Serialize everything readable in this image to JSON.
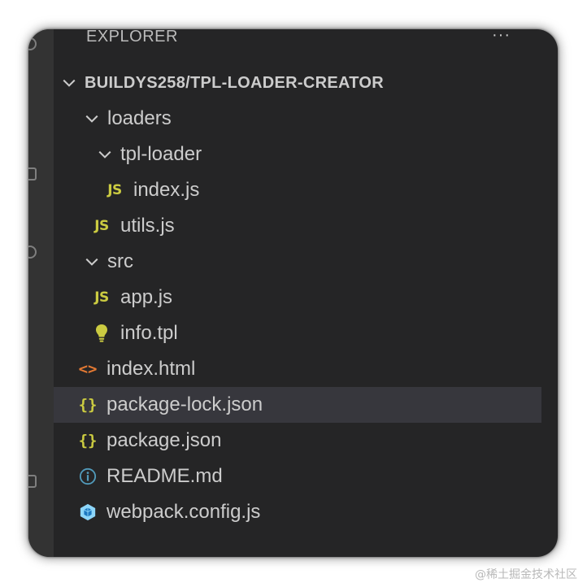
{
  "explorer": {
    "header": "EXPLORER",
    "more": "···"
  },
  "tree": {
    "root": {
      "label": "BUILDYS258/TPL-LOADER-CREATOR",
      "icon": "chevron-down-icon"
    },
    "items": [
      {
        "label": "loaders",
        "type": "folder",
        "icon": "chevron-down-icon"
      },
      {
        "label": "tpl-loader",
        "type": "folder",
        "icon": "chevron-down-icon"
      },
      {
        "label": "index.js",
        "type": "file",
        "icon": "js-icon",
        "badge": "JS"
      },
      {
        "label": "utils.js",
        "type": "file",
        "icon": "js-icon",
        "badge": "JS"
      },
      {
        "label": "src",
        "type": "folder",
        "icon": "chevron-down-icon"
      },
      {
        "label": "app.js",
        "type": "file",
        "icon": "js-icon",
        "badge": "JS"
      },
      {
        "label": "info.tpl",
        "type": "file",
        "icon": "lightbulb-icon"
      },
      {
        "label": "index.html",
        "type": "file",
        "icon": "html-icon",
        "badge": "<>"
      },
      {
        "label": "package-lock.json",
        "type": "file",
        "icon": "json-icon",
        "badge": "{}",
        "selected": true
      },
      {
        "label": "package.json",
        "type": "file",
        "icon": "json-icon",
        "badge": "{}"
      },
      {
        "label": "README.md",
        "type": "file",
        "icon": "info-icon"
      },
      {
        "label": "webpack.config.js",
        "type": "file",
        "icon": "webpack-icon"
      }
    ]
  },
  "colors": {
    "background": "#252526",
    "text": "#cccccc",
    "selected": "#37373d",
    "js": "#cbcb41",
    "html": "#e37933",
    "info": "#519aba",
    "webpack": "#8dd6f9"
  },
  "watermark": "@稀土掘金技术社区"
}
